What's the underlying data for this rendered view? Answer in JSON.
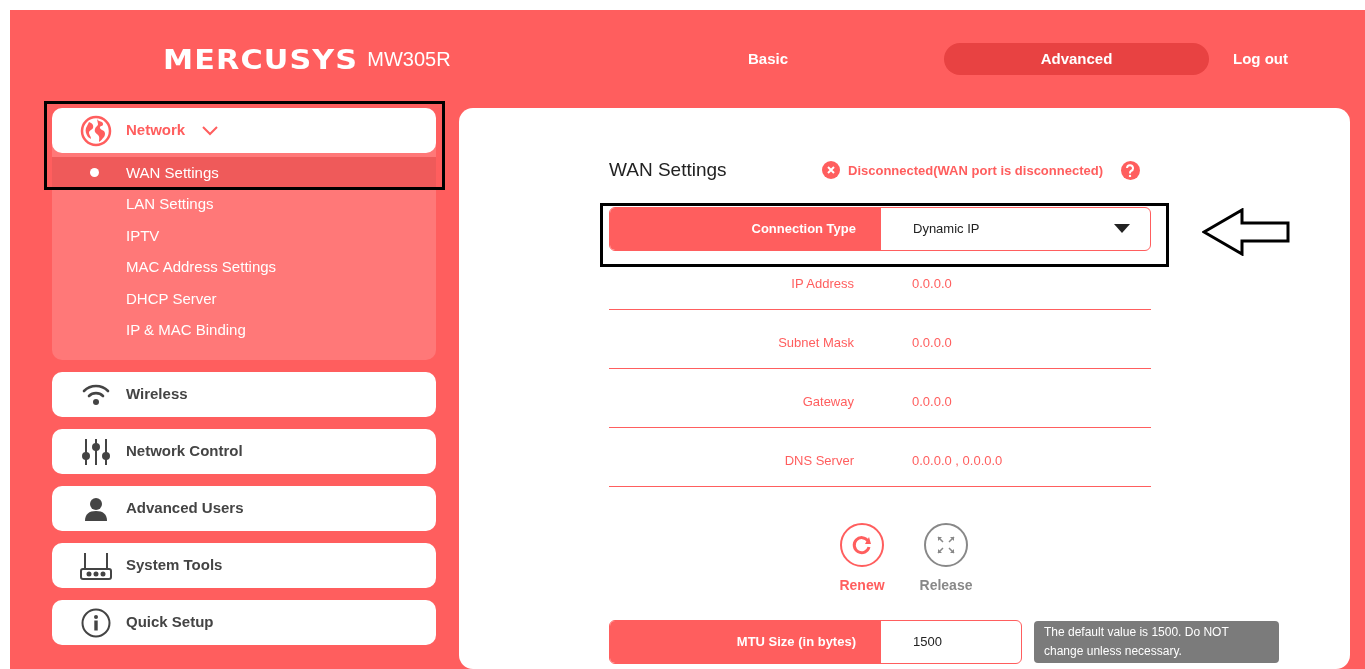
{
  "header": {
    "logo": "MERCUSYS",
    "model": "MW305R",
    "nav": [
      {
        "label": "Basic",
        "selected": false
      },
      {
        "label": "Advanced",
        "selected": true
      },
      {
        "label": "Log out",
        "selected": false
      }
    ]
  },
  "sidebar": {
    "items": [
      {
        "label": "Network",
        "expanded": true,
        "children": [
          {
            "label": "WAN Settings",
            "selected": true
          },
          {
            "label": "LAN Settings",
            "selected": false
          },
          {
            "label": "IPTV",
            "selected": false
          },
          {
            "label": "MAC Address Settings",
            "selected": false
          },
          {
            "label": "DHCP Server",
            "selected": false
          },
          {
            "label": "IP & MAC Binding",
            "selected": false
          }
        ]
      },
      {
        "label": "Wireless",
        "expanded": false
      },
      {
        "label": "Network Control",
        "expanded": false
      },
      {
        "label": "Advanced Users",
        "expanded": false
      },
      {
        "label": "System Tools",
        "expanded": false
      },
      {
        "label": "Quick Setup",
        "expanded": false
      }
    ]
  },
  "main": {
    "title": "WAN Settings",
    "status": {
      "text": "Disconnected(WAN port is disconnected)",
      "connected": false
    },
    "connection_type": {
      "label": "Connection Type",
      "value": "Dynamic IP"
    },
    "info": [
      {
        "label": "IP Address",
        "value": "0.0.0.0"
      },
      {
        "label": "Subnet Mask",
        "value": "0.0.0.0"
      },
      {
        "label": "Gateway",
        "value": "0.0.0.0"
      },
      {
        "label": "DNS Server",
        "value": "0.0.0.0 , 0.0.0.0"
      }
    ],
    "actions": [
      {
        "label": "Renew",
        "kind": "renew",
        "disabled": false
      },
      {
        "label": "Release",
        "kind": "release",
        "disabled": true
      }
    ],
    "mtu": {
      "label": "MTU Size (in bytes)",
      "value": "1500"
    },
    "hint": "The default value is 1500. Do NOT change unless necessary."
  }
}
